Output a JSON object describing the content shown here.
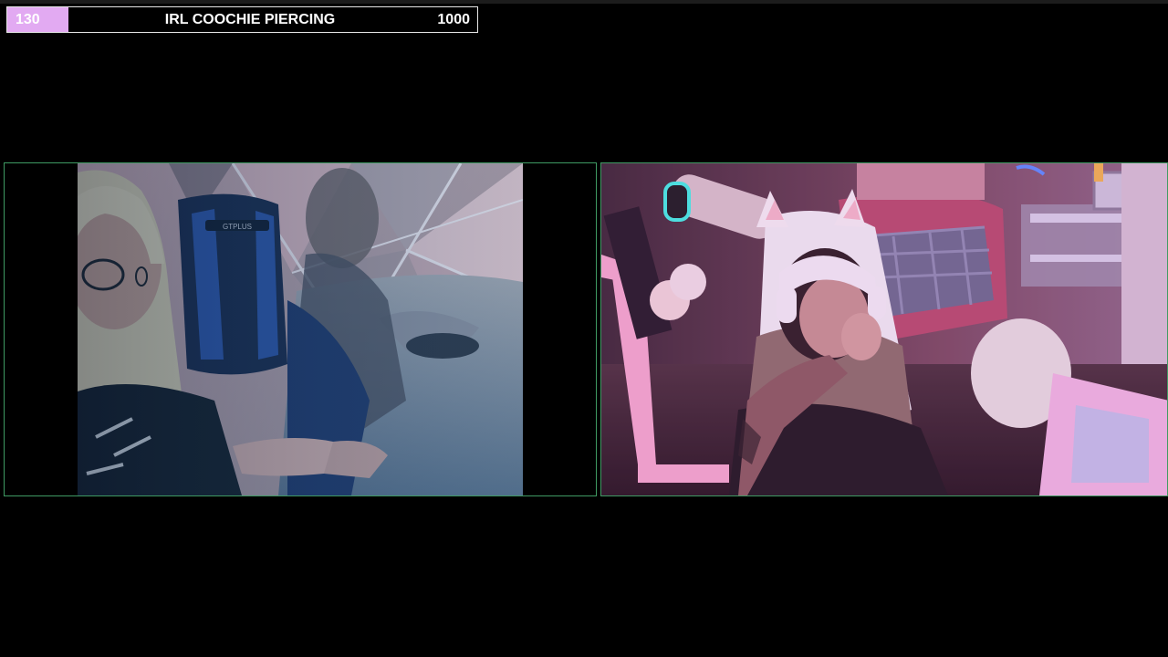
{
  "goal": {
    "current": "130",
    "title": "IRL COOCHIE PIERCING",
    "target": "1000",
    "progress_fraction": 0.13,
    "fill_color": "#e2aaf2",
    "border_color": "#e8e8e8"
  },
  "cameras": [
    {
      "id": "left",
      "frame_color": "#3f9a63",
      "chair_brand": "GTPLUS"
    },
    {
      "id": "right",
      "frame_color": "#3f9a63"
    }
  ]
}
